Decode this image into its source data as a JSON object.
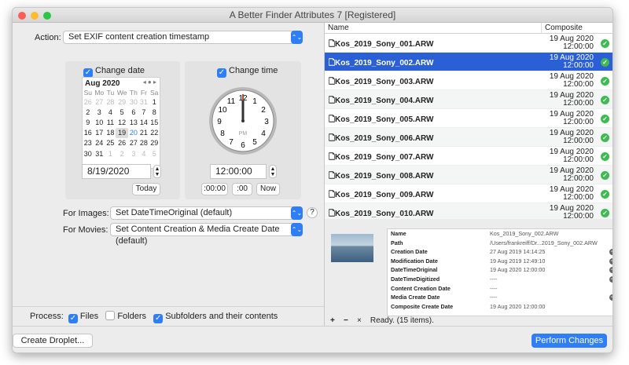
{
  "window": {
    "title": "A Better Finder Attributes 7 [Registered]"
  },
  "action": {
    "label": "Action:",
    "value": "Set EXIF content creation timestamp"
  },
  "date": {
    "checkbox": "Change date",
    "month": "Aug 2020",
    "weekdays": [
      "Su",
      "Mo",
      "Tu",
      "We",
      "Th",
      "Fr",
      "Sa"
    ],
    "weeks": [
      [
        "26",
        "27",
        "28",
        "29",
        "30",
        "31",
        "1"
      ],
      [
        "2",
        "3",
        "4",
        "5",
        "6",
        "7",
        "8"
      ],
      [
        "9",
        "10",
        "11",
        "12",
        "13",
        "14",
        "15"
      ],
      [
        "16",
        "17",
        "18",
        "19",
        "20",
        "21",
        "22"
      ],
      [
        "23",
        "24",
        "25",
        "26",
        "27",
        "28",
        "29"
      ],
      [
        "30",
        "31",
        "1",
        "2",
        "3",
        "4",
        "5"
      ]
    ],
    "selected_day": "19",
    "today_day": "20",
    "value": "8/19/2020",
    "today_button": "Today"
  },
  "time": {
    "checkbox": "Change time",
    "value": "12:00:00",
    "ampm": "PM",
    "btn1": ":00:00",
    "btn2": ":00",
    "now_button": "Now",
    "numbers": [
      "12",
      "1",
      "2",
      "3",
      "4",
      "5",
      "6",
      "7",
      "8",
      "9",
      "10",
      "11"
    ]
  },
  "images": {
    "label": "For Images:",
    "value": "Set DateTimeOriginal (default)",
    "help": "?"
  },
  "movies": {
    "label": "For Movies:",
    "value": "Set Content Creation & Media Create Date (default)"
  },
  "process": {
    "label": "Process:",
    "files": "Files",
    "folders": "Folders",
    "subfolders": "Subfolders and their contents"
  },
  "buttons": {
    "droplet": "Create Droplet...",
    "perform": "Perform Changes"
  },
  "list": {
    "col_name": "Name",
    "col_composite": "Composite",
    "rows": [
      {
        "name": "Kos_2019_Sony_001.ARW",
        "date": "19 Aug 2020",
        "time": "12:00:00"
      },
      {
        "name": "Kos_2019_Sony_002.ARW",
        "date": "19 Aug 2020",
        "time": "12:00:00"
      },
      {
        "name": "Kos_2019_Sony_003.ARW",
        "date": "19 Aug 2020",
        "time": "12:00:00"
      },
      {
        "name": "Kos_2019_Sony_004.ARW",
        "date": "19 Aug 2020",
        "time": "12:00:00"
      },
      {
        "name": "Kos_2019_Sony_005.ARW",
        "date": "19 Aug 2020",
        "time": "12:00:00"
      },
      {
        "name": "Kos_2019_Sony_006.ARW",
        "date": "19 Aug 2020",
        "time": "12:00:00"
      },
      {
        "name": "Kos_2019_Sony_007.ARW",
        "date": "19 Aug 2020",
        "time": "12:00:00"
      },
      {
        "name": "Kos_2019_Sony_008.ARW",
        "date": "19 Aug 2020",
        "time": "12:00:00"
      },
      {
        "name": "Kos_2019_Sony_009.ARW",
        "date": "19 Aug 2020",
        "time": "12:00:00"
      },
      {
        "name": "Kos_2019_Sony_010.ARW",
        "date": "19 Aug 2020",
        "time": "12:00:00"
      }
    ]
  },
  "details": [
    {
      "k": "Name",
      "v": "Kos_2019_Sony_002.ARW",
      "go": false
    },
    {
      "k": "Path",
      "v": "/Users/frankreiff/Dr...2019_Sony_002.ARW",
      "go": false
    },
    {
      "k": "Creation Date",
      "v": "27 Aug 2019 14:14:25",
      "go": true
    },
    {
      "k": "Modification Date",
      "v": "19 Aug 2019 12:49:10",
      "go": true
    },
    {
      "k": "DateTimeOriginal",
      "v": "19 Aug 2020 12:00:00",
      "go": true
    },
    {
      "k": "DateTimeDigitized",
      "v": "----",
      "go": true
    },
    {
      "k": "Content Creation Date",
      "v": "----",
      "go": false
    },
    {
      "k": "Media Create Date",
      "v": "----",
      "go": true
    },
    {
      "k": "Composite Create Date",
      "v": "19 Aug 2020 12:00:00",
      "go": false
    }
  ],
  "status": {
    "text": "Ready. (15 items).",
    "add": "+",
    "remove": "−",
    "clear": "×"
  }
}
